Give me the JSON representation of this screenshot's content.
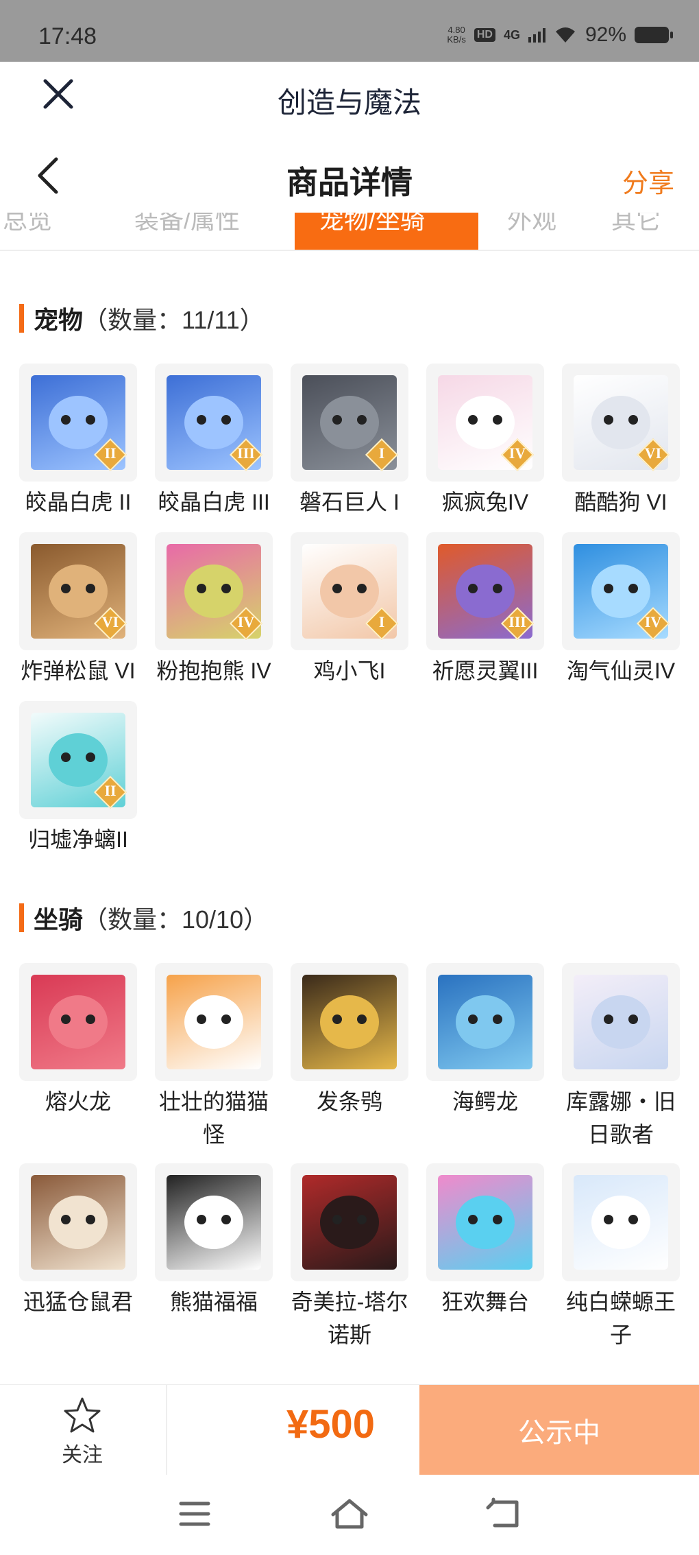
{
  "status_bar": {
    "time": "17:48",
    "net_speed_value": "4.80",
    "net_speed_unit": "KB/s",
    "hd": "HD",
    "network": "4G",
    "battery": "92%"
  },
  "app_bar": {
    "title": "创造与魔法",
    "close_icon": "close-icon"
  },
  "header": {
    "title": "商品详情",
    "share": "分享",
    "back_icon": "chevron-left-icon"
  },
  "tabs": [
    "总览",
    "装备/属性",
    "宠物/坐骑",
    "外观",
    "其它"
  ],
  "active_tab": 2,
  "sections": {
    "pets": {
      "name": "宠物",
      "count": "（数量：11/11）",
      "items": [
        {
          "label": "皎晶白虎 II",
          "rank": "II"
        },
        {
          "label": "皎晶白虎 III",
          "rank": "III"
        },
        {
          "label": "磐石巨人 I",
          "rank": "I"
        },
        {
          "label": "疯疯兔IV",
          "rank": "IV"
        },
        {
          "label": "酷酷狗 VI",
          "rank": "VI"
        },
        {
          "label": "炸弹松鼠 VI",
          "rank": "VI"
        },
        {
          "label": "粉抱抱熊 IV",
          "rank": "IV"
        },
        {
          "label": "鸡小飞I",
          "rank": "I"
        },
        {
          "label": "祈愿灵翼III",
          "rank": "III"
        },
        {
          "label": "淘气仙灵IV",
          "rank": "IV"
        },
        {
          "label": "归墟净螭II",
          "rank": "II"
        }
      ]
    },
    "mounts": {
      "name": "坐骑",
      "count": "（数量：10/10）",
      "items": [
        {
          "label": "熔火龙"
        },
        {
          "label": "壮壮的猫猫怪"
        },
        {
          "label": "发条鸮"
        },
        {
          "label": "海鳄龙"
        },
        {
          "label": "库露娜・旧日歌者"
        },
        {
          "label": "迅猛仓鼠君"
        },
        {
          "label": "熊猫福福"
        },
        {
          "label": "奇美拉-塔尔诺斯"
        },
        {
          "label": "狂欢舞台"
        },
        {
          "label": "纯白蝾螈王子"
        }
      ]
    }
  },
  "bottom_bar": {
    "follow": "关注",
    "price": "¥500",
    "status_button": "公示中"
  },
  "colors": {
    "accent": "#f86c12",
    "price": "#f26a12",
    "status_button_bg": "#fbab7c",
    "status_bar_bg": "#9a9a9a"
  }
}
